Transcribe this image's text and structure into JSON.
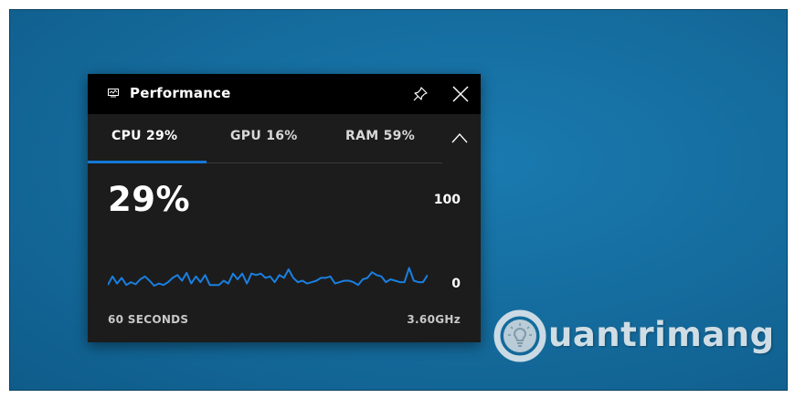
{
  "widget": {
    "title": "Performance",
    "tabs": [
      {
        "label": "CPU 29%",
        "selected": true
      },
      {
        "label": "GPU 16%",
        "selected": false
      },
      {
        "label": "RAM 59%",
        "selected": false
      }
    ],
    "current_value": "29%",
    "scale_max": "100",
    "scale_min": "0",
    "time_window": "60 SECONDS",
    "frequency": "3.60GHz"
  },
  "watermark": {
    "text": "uantrimang"
  },
  "colors": {
    "accent": "#1479d8",
    "graph_line": "#1a7fe0",
    "desktop": "#146a9b",
    "widget_bg": "#1c1c1c"
  },
  "icons": [
    "performance-monitor-icon",
    "pin-icon",
    "close-icon",
    "chevron-up-icon",
    "lightbulb-logo-icon"
  ],
  "chart_data": {
    "type": "line",
    "xlabel": "60 SECONDS",
    "ylim": [
      0,
      100
    ],
    "values": [
      10,
      22,
      12,
      20,
      10,
      14,
      11,
      18,
      22,
      16,
      9,
      12,
      10,
      14,
      20,
      24,
      16,
      27,
      12,
      22,
      14,
      24,
      10,
      10,
      10,
      16,
      12,
      26,
      18,
      26,
      12,
      26,
      24,
      26,
      20,
      22,
      14,
      24,
      20,
      32,
      20,
      14,
      16,
      12,
      14,
      16,
      20,
      20,
      22,
      12,
      14,
      16,
      16,
      14,
      10,
      18,
      20,
      28,
      24,
      22,
      14,
      18,
      16,
      14,
      14,
      34,
      16,
      14,
      14,
      24
    ]
  }
}
